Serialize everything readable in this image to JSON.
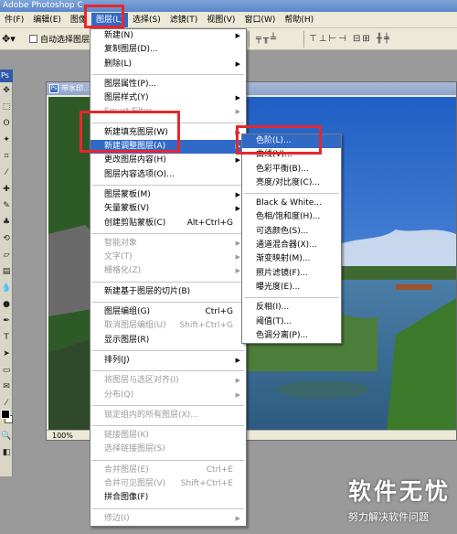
{
  "app": {
    "title": "Adobe Photoshop C"
  },
  "menubar": {
    "items": [
      {
        "label": "件(F)"
      },
      {
        "label": "编辑(E)"
      },
      {
        "label": "图像"
      },
      {
        "label": "图层(L)",
        "active": true
      },
      {
        "label": "选择(S)"
      },
      {
        "label": "滤镜(T)"
      },
      {
        "label": "视图(V)"
      },
      {
        "label": "窗口(W)"
      },
      {
        "label": "帮助(H)"
      }
    ]
  },
  "options": {
    "auto_select_label": "自动选择图层"
  },
  "document": {
    "title": "带水印...",
    "zoom": "100%"
  },
  "layer_menu": {
    "groups": [
      [
        {
          "label": "新建(N)",
          "submenu": true
        },
        {
          "label": "复制图层(D)..."
        },
        {
          "label": "删除(L)",
          "submenu": true
        }
      ],
      [
        {
          "label": "图层属性(P)..."
        },
        {
          "label": "图层样式(Y)",
          "submenu": true
        },
        {
          "label": "Smart Filter",
          "disabled": true,
          "submenu": true
        }
      ],
      [
        {
          "label": "新建填充图层(W)",
          "submenu": true
        },
        {
          "label": "新建调整图层(A)",
          "submenu": true,
          "highlight": true
        },
        {
          "label": "更改图层内容(H)",
          "submenu": true
        },
        {
          "label": "图层内容选项(O)..."
        }
      ],
      [
        {
          "label": "图层蒙板(M)",
          "submenu": true
        },
        {
          "label": "矢量蒙板(V)",
          "submenu": true
        },
        {
          "label": "创建剪贴蒙板(C)",
          "shortcut": "Alt+Ctrl+G"
        }
      ],
      [
        {
          "label": "智能对象",
          "disabled": true,
          "submenu": true
        },
        {
          "label": "文字(T)",
          "disabled": true,
          "submenu": true
        },
        {
          "label": "栅格化(Z)",
          "disabled": true,
          "submenu": true
        }
      ],
      [
        {
          "label": "新建基于图层的切片(B)"
        }
      ],
      [
        {
          "label": "图层编组(G)",
          "shortcut": "Ctrl+G"
        },
        {
          "label": "取消图层编组(U)",
          "shortcut": "Shift+Ctrl+G",
          "disabled": true
        },
        {
          "label": "显示图层(R)"
        }
      ],
      [
        {
          "label": "排列(J)",
          "submenu": true
        }
      ],
      [
        {
          "label": "将图层与选区对齐(I)",
          "disabled": true,
          "submenu": true
        },
        {
          "label": "分布(Q)",
          "disabled": true,
          "submenu": true
        }
      ],
      [
        {
          "label": "锁定组内的所有图层(X)...",
          "disabled": true
        }
      ],
      [
        {
          "label": "链接图层(K)",
          "disabled": true
        },
        {
          "label": "选择链接图层(S)",
          "disabled": true
        }
      ],
      [
        {
          "label": "合并图层(E)",
          "shortcut": "Ctrl+E",
          "disabled": true
        },
        {
          "label": "合并可见图层(V)",
          "shortcut": "Shift+Ctrl+E",
          "disabled": true
        },
        {
          "label": "拼合图像(F)"
        }
      ],
      [
        {
          "label": "修边(I)",
          "disabled": true,
          "submenu": true
        }
      ]
    ]
  },
  "adjust_menu": {
    "groups": [
      [
        {
          "label": "色阶(L)...",
          "highlight": true
        },
        {
          "label": "曲线(V)..."
        },
        {
          "label": "色彩平衡(B)..."
        },
        {
          "label": "亮度/对比度(C)..."
        }
      ],
      [
        {
          "label": "Black & White..."
        },
        {
          "label": "色相/饱和度(H)..."
        },
        {
          "label": "可选颜色(S)..."
        },
        {
          "label": "通道混合器(X)..."
        },
        {
          "label": "渐变映射(M)..."
        },
        {
          "label": "照片滤镜(F)..."
        },
        {
          "label": "曝光度(E)..."
        }
      ],
      [
        {
          "label": "反相(I)..."
        },
        {
          "label": "阈值(T)..."
        },
        {
          "label": "色调分离(P)..."
        }
      ]
    ]
  },
  "watermark": {
    "logo": "软件无忧",
    "sub": "努力解决软件问题"
  },
  "colors": {
    "highlight": "#3169c6",
    "annotation": "#e8262d",
    "menu_bg": "#ece9d8"
  }
}
